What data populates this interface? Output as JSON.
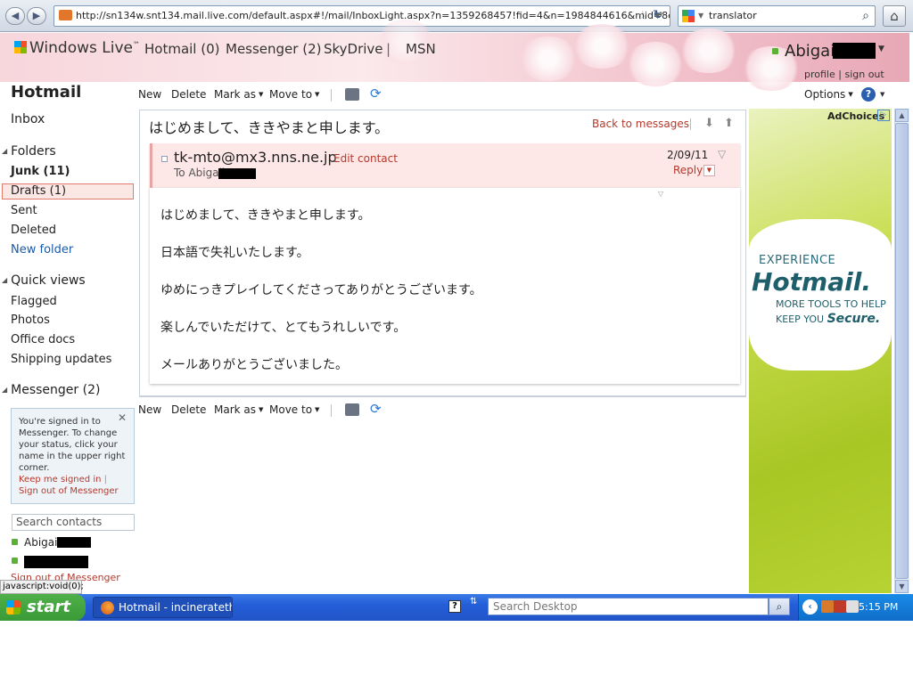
{
  "browser": {
    "url": "http://sn134w.snt134.mail.live.com/default.aspx#!/mail/InboxLight.aspx?n=1359268457!fid=4&n=1984844616&mid=8e4ac",
    "search_text": "translator",
    "back_icon": "back-arrow-icon",
    "forward_icon": "forward-arrow-icon"
  },
  "header": {
    "logo": "Windows Live",
    "logo_tm": "™",
    "nav": [
      "Hotmail (0)",
      "Messenger (2)",
      "SkyDrive",
      "|",
      "MSN"
    ],
    "user_name": "Abigail",
    "profile_link": "profile",
    "signout_link": "sign out",
    "link_sep": "|"
  },
  "sidebar": {
    "title": "Hotmail",
    "inbox": "Inbox",
    "folders_heading": "Folders",
    "folders": [
      "Junk (11)",
      "Drafts (1)",
      "Sent",
      "Deleted"
    ],
    "new_folder": "New folder",
    "quickviews_heading": "Quick views",
    "quickviews": [
      "Flagged",
      "Photos",
      "Office docs",
      "Shipping updates"
    ],
    "messenger_heading": "Messenger (2)",
    "messenger_note": "You're signed in to Messenger. To change your status, click your name in the upper right corner.",
    "keep_signed": "Keep me signed in",
    "sign_out_short": "Sign out of Messenger",
    "search_contacts_placeholder": "Search contacts",
    "contact_1": "Abigail",
    "signout_messenger": "Sign out of Messenger",
    "status_url": "javascript:void(0);"
  },
  "toolbar": {
    "new": "New",
    "delete": "Delete",
    "mark_as": "Mark as",
    "move_to": "Move to",
    "options": "Options",
    "help": "?"
  },
  "message": {
    "subject": "はじめまして、ききやまと申します。",
    "back_to_messages": "Back to messages",
    "sender": "tk-mto@mx3.nns.ne.jp",
    "edit_contact": "Edit contact",
    "to_prefix": "To Abigail",
    "date": "2/09/11",
    "reply": "Reply",
    "body": [
      "はじめまして、ききやまと申します。",
      "日本語で失礼いたします。",
      "ゆめにっきプレイしてくださってありがとうございます。",
      "楽しんでいただけて、とてもうれしいです。",
      "メールありがとうございました。"
    ]
  },
  "ad": {
    "adchoices": "AdChoices",
    "experience": "EXPERIENCE",
    "brand": "Hotmail.",
    "line1": "MORE TOOLS TO HELP",
    "line2": "KEEP YOU",
    "secure": "Secure."
  },
  "taskbar": {
    "start": "start",
    "task_item": "Hotmail - incinerateth...",
    "desktop_search_placeholder": "Search Desktop",
    "clock": "5:15 PM"
  },
  "colors": {
    "link_red": "#b5392c",
    "header_pink": "#f7d6dc",
    "taskbar_blue": "#245ed8",
    "ad_green": "#a8c624"
  }
}
